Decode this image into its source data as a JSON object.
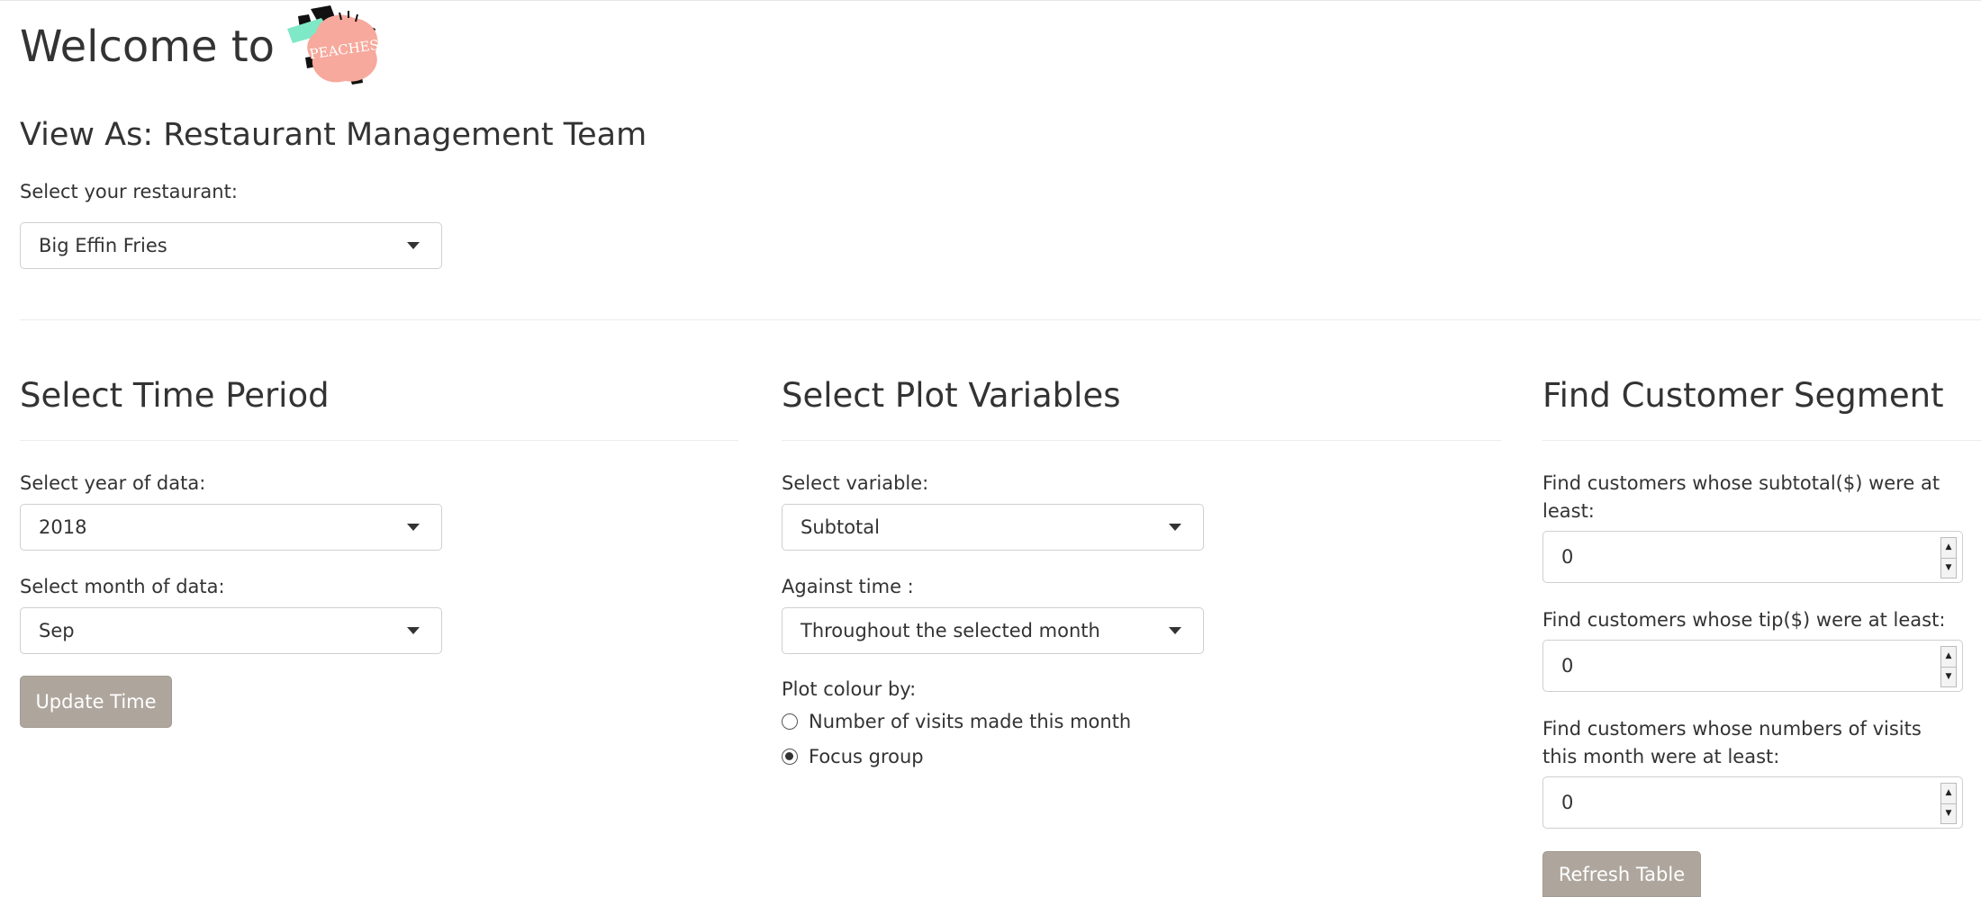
{
  "header": {
    "welcome_text": "Welcome to",
    "logo_text": "PEACHES"
  },
  "view_as": "View As: Restaurant Management Team",
  "restaurant": {
    "label": "Select your restaurant:",
    "value": "Big Effin Fries"
  },
  "time_period": {
    "title": "Select Time Period",
    "year_label": "Select year of data:",
    "year_value": "2018",
    "month_label": "Select month of data:",
    "month_value": "Sep",
    "update_button": "Update Time"
  },
  "plot_vars": {
    "title": "Select Plot Variables",
    "variable_label": "Select variable:",
    "variable_value": "Subtotal",
    "time_label": "Against time :",
    "time_value": "Throughout the selected month",
    "colour_label": "Plot colour by:",
    "colour_options": [
      {
        "label": "Number of visits made this month",
        "checked": false
      },
      {
        "label": "Focus group",
        "checked": true
      }
    ]
  },
  "segment": {
    "title": "Find Customer Segment",
    "subtotal_label": "Find customers whose subtotal($) were at least:",
    "subtotal_value": "0",
    "tip_label": "Find customers whose tip($) were at least:",
    "tip_value": "0",
    "visits_label": "Find customers whose numbers of visits this month were at least:",
    "visits_value": "0",
    "refresh_button": "Refresh Table"
  },
  "colors": {
    "button_bg": "#aea69d",
    "logo_pink": "#f6a99c",
    "logo_mint": "#7fe8c6"
  }
}
